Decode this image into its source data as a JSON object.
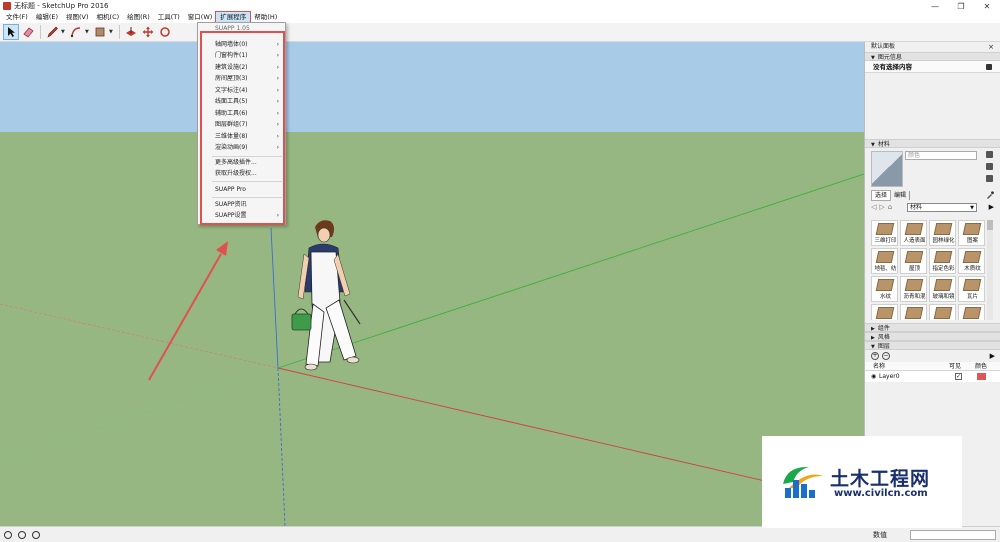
{
  "window": {
    "title": "无标题 - SketchUp Pro 2016",
    "controls": [
      "—",
      "❐",
      "✕"
    ]
  },
  "menubar": {
    "items": [
      "文件(F)",
      "编辑(E)",
      "视图(V)",
      "相机(C)",
      "绘图(R)",
      "工具(T)",
      "窗口(W)",
      "扩展程序",
      "帮助(H)"
    ],
    "active_index": 7
  },
  "extensions_menu": {
    "items": [
      {
        "label": "SUAPP 1.05",
        "submenu": false,
        "dim": true
      },
      {
        "label": "轴网墙体(0)",
        "submenu": true
      },
      {
        "label": "门窗构件(1)",
        "submenu": true
      },
      {
        "label": "建筑设施(2)",
        "submenu": true
      },
      {
        "label": "房间屋顶(3)",
        "submenu": true
      },
      {
        "label": "文字标注(4)",
        "submenu": true
      },
      {
        "label": "线面工具(5)",
        "submenu": true
      },
      {
        "label": "辅助工具(6)",
        "submenu": true
      },
      {
        "label": "图层群组(7)",
        "submenu": true
      },
      {
        "label": "三维体量(8)",
        "submenu": true
      },
      {
        "label": "渲染动画(9)",
        "submenu": true
      },
      {
        "label": "更多高级插件...",
        "submenu": false
      },
      {
        "label": "获取升级授权...",
        "submenu": false
      },
      {
        "label": "SUAPP Pro",
        "submenu": false
      },
      {
        "label": "SUAPP资讯",
        "submenu": false
      },
      {
        "label": "SUAPP设置",
        "submenu": true
      }
    ]
  },
  "tray": {
    "title": "默认面板",
    "entity_info": {
      "header": "图元信息",
      "text": "没有选择内容"
    },
    "materials": {
      "header": "材料",
      "name_placeholder": "颜色",
      "tabs": [
        "选择",
        "编辑"
      ],
      "library": "材料",
      "items": [
        "三维打印",
        "人造表面",
        "园林绿化",
        "图案",
        "地毯、纺",
        "屋顶",
        "指定色彩",
        "木质纹",
        "水纹",
        "沥青和混",
        "玻璃和镜",
        "瓦片",
        "",
        "",
        "",
        ""
      ]
    },
    "components_header": "组件",
    "styles_header": "风格",
    "layers": {
      "header": "图层",
      "columns": {
        "name": "名称",
        "visible": "可见",
        "color": "颜色"
      },
      "rows": [
        {
          "name": "Layer0",
          "visible": true,
          "color": "#e05555"
        }
      ]
    }
  },
  "statusbar": {
    "measure_label": "数值"
  },
  "watermark": {
    "name": "土木工程网",
    "url": "www.civilcn.com"
  },
  "colors": {
    "sky": "#a8cbe8",
    "ground": "#97b782",
    "axis_red": "#d04040",
    "axis_green": "#3fae3f",
    "axis_blue": "#3a6fd0",
    "highlight": "#e05050"
  }
}
